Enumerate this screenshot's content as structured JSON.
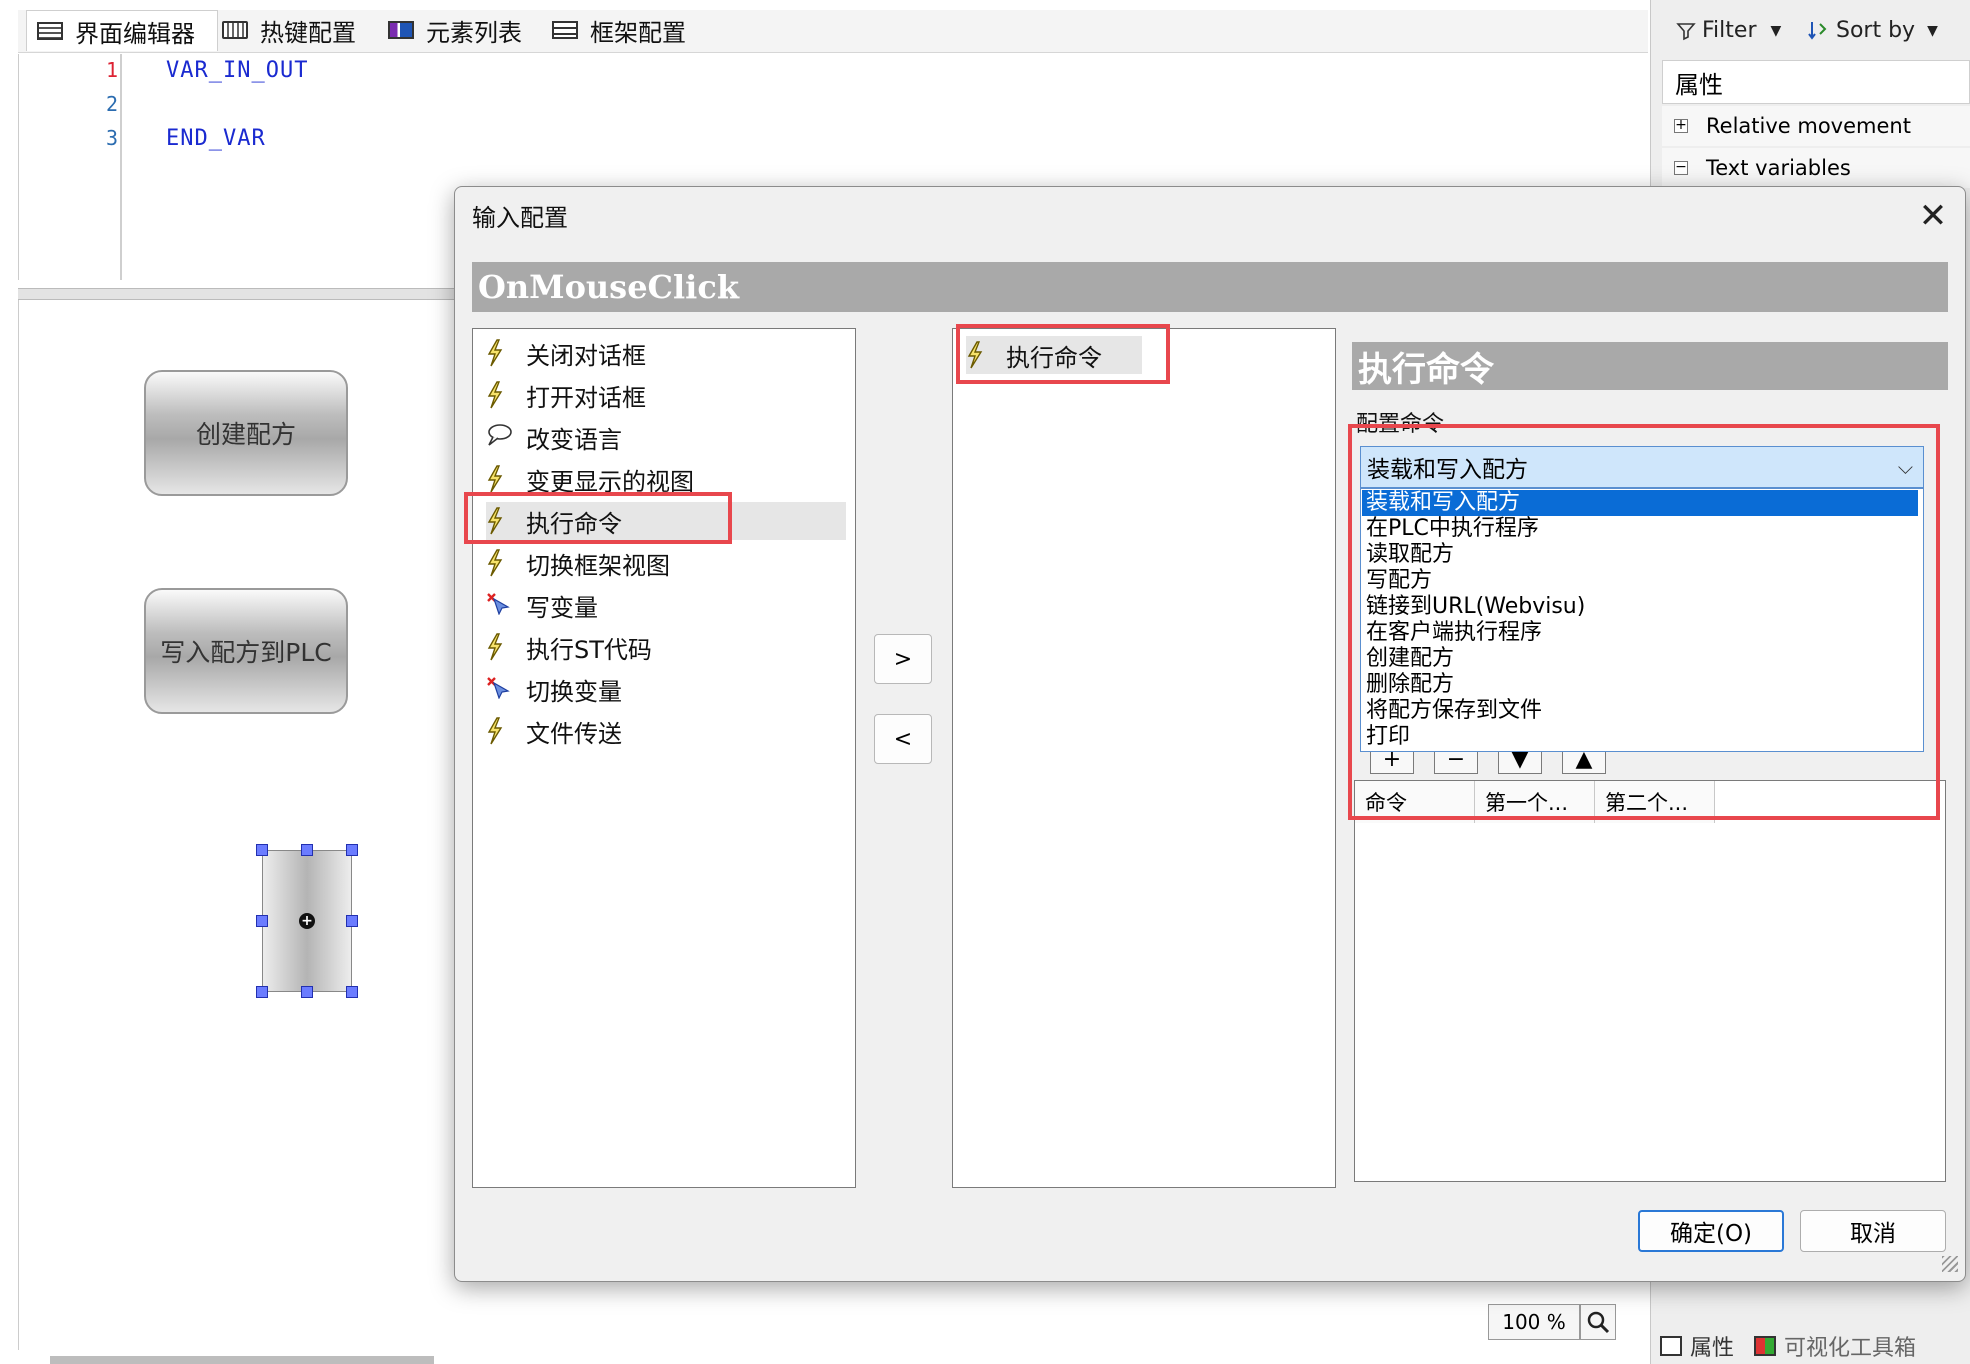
{
  "tabs": [
    {
      "label": "界面编辑器",
      "icon": "editor-icon",
      "active": true
    },
    {
      "label": "热键配置",
      "icon": "keyboard-icon"
    },
    {
      "label": "元素列表",
      "icon": "list-icon"
    },
    {
      "label": "框架配置",
      "icon": "frame-icon"
    }
  ],
  "code": {
    "lines": [
      {
        "num": "1",
        "text": "VAR_IN_OUT"
      },
      {
        "num": "2",
        "text": ""
      },
      {
        "num": "3",
        "text": "END_VAR"
      }
    ]
  },
  "canvas": {
    "buttons": [
      "创建配方",
      "写入配方到PLC"
    ],
    "zoom": "100 %"
  },
  "right_panel": {
    "filter_label": "Filter",
    "sort_label": "Sort by",
    "header": "属性",
    "rows": [
      {
        "label": "Relative movement",
        "expander": "+"
      },
      {
        "label": "Text variables",
        "expander": "−"
      }
    ],
    "bottom_tabs": [
      "属性",
      "可视化工具箱"
    ]
  },
  "dialog": {
    "title": "输入配置",
    "event": "OnMouseClick",
    "available_actions": [
      {
        "label": "关闭对话框",
        "icon": "bolt-icon"
      },
      {
        "label": "打开对话框",
        "icon": "bolt-icon"
      },
      {
        "label": "改变语言",
        "icon": "speech-icon"
      },
      {
        "label": "变更显示的视图",
        "icon": "bolt-icon"
      },
      {
        "label": "执行命令",
        "icon": "bolt-icon"
      },
      {
        "label": "切换框架视图",
        "icon": "bolt-icon"
      },
      {
        "label": "写变量",
        "icon": "write-var-icon"
      },
      {
        "label": "执行ST代码",
        "icon": "bolt-icon"
      },
      {
        "label": "切换变量",
        "icon": "write-var-icon"
      },
      {
        "label": "文件传送",
        "icon": "bolt-icon"
      }
    ],
    "add_button": ">",
    "remove_button": "<",
    "selected_actions": [
      {
        "label": "执行命令",
        "icon": "bolt-icon"
      }
    ],
    "detail_header": "执行命令",
    "config_label": "配置命令",
    "combo_value": "装载和写入配方",
    "combo_options": [
      "装载和写入配方",
      "在PLC中执行程序",
      "读取配方",
      "写配方",
      "链接到URL(Webvisu)",
      "在客户端执行程序",
      "创建配方",
      "删除配方",
      "将配方保存到文件",
      "打印"
    ],
    "table_columns": [
      "命令",
      "第一个...",
      "第二个..."
    ],
    "ok_label": "确定(O)",
    "cancel_label": "取消",
    "colors": {
      "highlight": "#e8474d",
      "selection": "#0a6cd6",
      "header_bg": "#a9a9a9"
    }
  }
}
